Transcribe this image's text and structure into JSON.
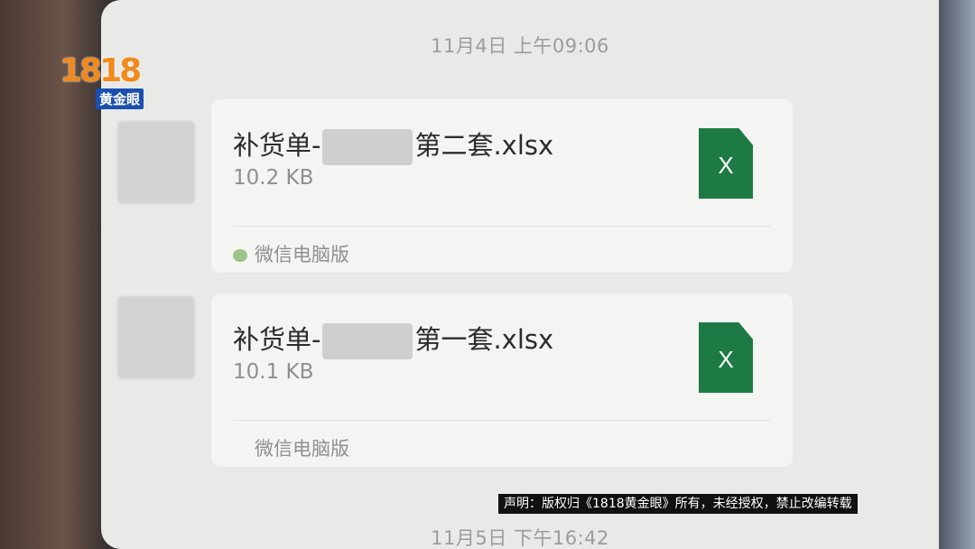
{
  "logo": {
    "number": "1818",
    "text": "黄金眼"
  },
  "chat": {
    "timestamp_top": "11月4日 上午09:06",
    "timestamp_bottom": "11月5日 下午16:42",
    "messages": [
      {
        "file_name_prefix": "补货单-",
        "file_name_suffix": "第二套.xlsx",
        "file_size": "10.2 KB",
        "file_icon": "excel-icon",
        "file_icon_letter": "X",
        "source": "微信电脑版"
      },
      {
        "file_name_prefix": "补货单-",
        "file_name_suffix": "第一套.xlsx",
        "file_size": "10.1 KB",
        "file_icon": "excel-icon",
        "file_icon_letter": "X",
        "source": "微信电脑版"
      }
    ]
  },
  "disclaimer": "声明：版权归《1818黄金眼》所有，未经授权，禁止改编转载",
  "colors": {
    "excel_green": "#1e7a44",
    "logo_orange": "#f08a1c",
    "logo_blue": "#1a4fb0"
  }
}
